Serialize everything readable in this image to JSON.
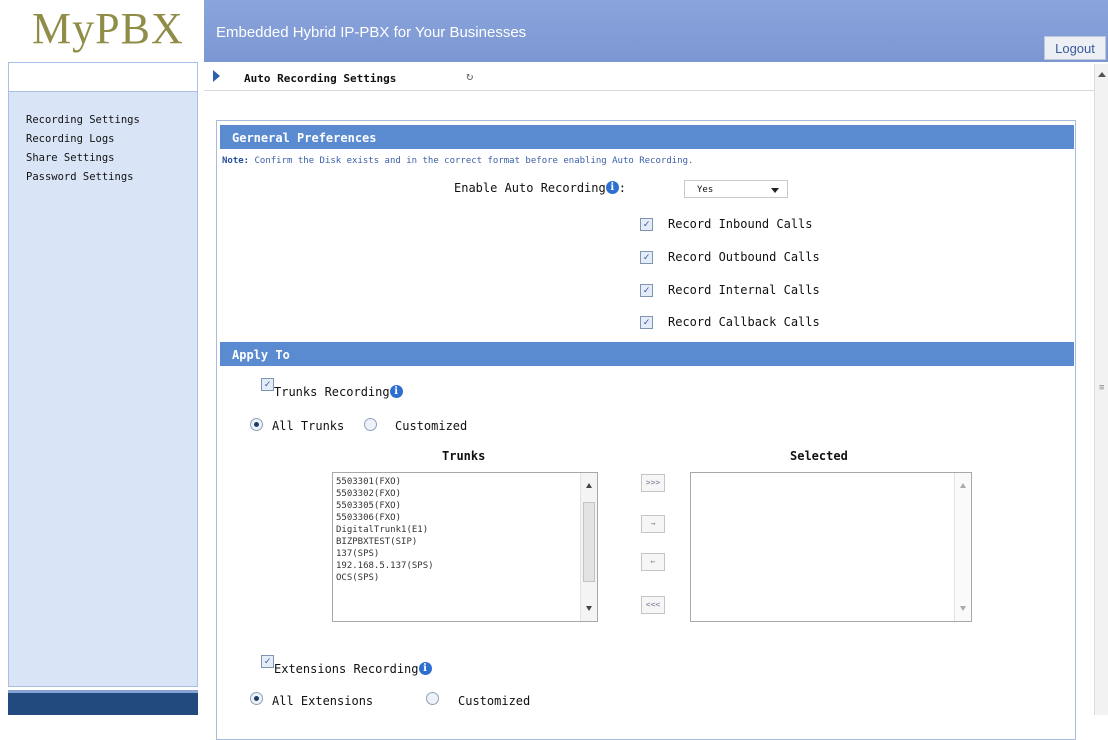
{
  "header": {
    "logo": "MyPBX",
    "slogan": "Embedded Hybrid IP-PBX for Your Businesses",
    "logout_label": "Logout"
  },
  "sidebar": {
    "items": [
      {
        "label": "Recording Settings"
      },
      {
        "label": "Recording Logs"
      },
      {
        "label": "Share Settings"
      },
      {
        "label": "Password Settings"
      }
    ]
  },
  "breadcrumb": {
    "title": "Auto Recording Settings",
    "refresh_icon": "refresh-icon"
  },
  "general": {
    "heading": "Gerneral Preferences",
    "note_prefix": "Note:",
    "note_text": " Confirm the Disk exists and in the correct format before enabling Auto Recording.",
    "enable_label": "Enable Auto Recording",
    "enable_suffix": ":",
    "enable_value": "Yes",
    "options": [
      {
        "label": "Record Inbound Calls",
        "checked": true
      },
      {
        "label": "Record Outbound Calls",
        "checked": true
      },
      {
        "label": "Record Internal Calls",
        "checked": true
      },
      {
        "label": "Record Callback Calls",
        "checked": true
      }
    ]
  },
  "apply": {
    "heading": "Apply To",
    "trunks_recording_label": "Trunks Recording",
    "trunks_recording_checked": true,
    "all_trunks_label": "All Trunks",
    "customized_label": "Customized",
    "trunks_column": "Trunks",
    "selected_column": "Selected",
    "trunks": [
      "5503301(FXO)",
      "5503302(FXO)",
      "5503305(FXO)",
      "5503306(FXO)",
      "DigitalTrunk1(E1)",
      "BIZPBXTEST(SIP)",
      "137(SPS)",
      "192.168.5.137(SPS)",
      "OCS(SPS)"
    ],
    "move_buttons": [
      ">>>",
      "→",
      "←",
      "<<<"
    ],
    "extensions_recording_label": "Extensions Recording",
    "extensions_recording_checked": true,
    "all_extensions_label": "All Extensions",
    "customized_ext_label": "Customized"
  }
}
